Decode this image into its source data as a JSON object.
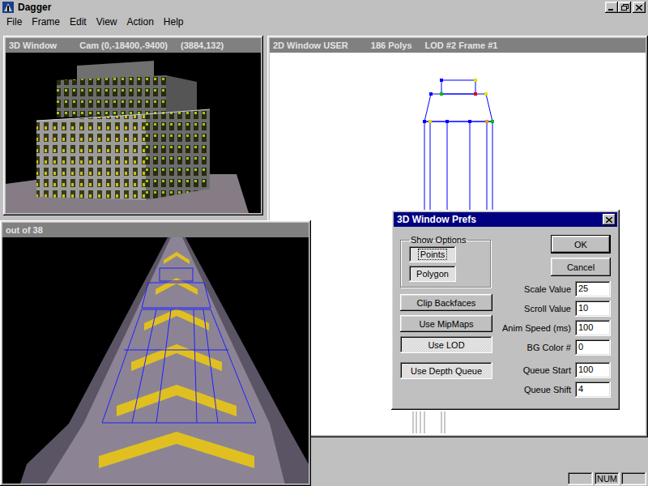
{
  "app": {
    "title": "Dagger"
  },
  "menu": [
    {
      "label": "File"
    },
    {
      "label": "Frame"
    },
    {
      "label": "Edit"
    },
    {
      "label": "View"
    },
    {
      "label": "Action"
    },
    {
      "label": "Help"
    }
  ],
  "windows": {
    "view3d": {
      "title": "3D Window",
      "info": [
        "Cam (0,-18400,-9400)",
        "(3884,132)"
      ]
    },
    "view2d": {
      "title": "2D Window USER",
      "info": [
        "186 Polys",
        "LOD #2 Frame #1"
      ]
    },
    "texture": {
      "title": "out of 38",
      "info": []
    }
  },
  "dialog": {
    "title": "3D Window Prefs",
    "show_options": {
      "label": "Show Options",
      "items": [
        {
          "label": "Points",
          "checked": true,
          "focused": true
        },
        {
          "label": "Polygon",
          "checked": true,
          "focused": false
        }
      ]
    },
    "toggles": [
      {
        "label": "Clip Backfaces",
        "checked": false
      },
      {
        "label": "Use MipMaps",
        "checked": false
      },
      {
        "label": "Use LOD",
        "checked": true
      },
      {
        "label": "Use Depth Queue",
        "checked": true
      }
    ],
    "buttons": [
      {
        "label": "OK",
        "default": true
      },
      {
        "label": "Cancel",
        "default": false
      }
    ],
    "field_groups": [
      [
        {
          "label": "Scale Value",
          "value": "25"
        },
        {
          "label": "Scroll Value",
          "value": "10"
        },
        {
          "label": "Anim Speed (ms)",
          "value": "100"
        },
        {
          "label": "BG Color #",
          "value": "0"
        }
      ],
      [
        {
          "label": "Queue Start",
          "value": "100"
        },
        {
          "label": "Queue Shift",
          "value": "4"
        }
      ]
    ]
  },
  "status_bar": {
    "panels": [
      "",
      "NUM",
      ""
    ]
  }
}
